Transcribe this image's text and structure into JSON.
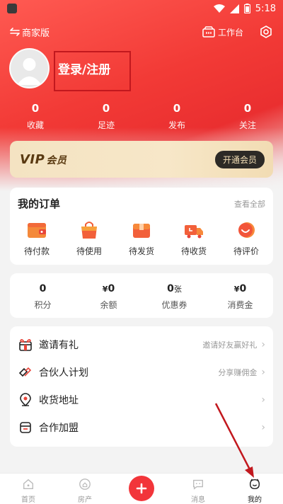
{
  "status_bar": {
    "time": "5:18"
  },
  "header": {
    "merchant_label": "商家版",
    "workbench_label": "工作台"
  },
  "profile": {
    "login_text": "登录/注册"
  },
  "stats": [
    {
      "value": "0",
      "label": "收藏"
    },
    {
      "value": "0",
      "label": "足迹"
    },
    {
      "value": "0",
      "label": "发布"
    },
    {
      "value": "0",
      "label": "关注"
    }
  ],
  "vip": {
    "logo": "VIP",
    "logo_suffix": "会员",
    "button": "开通会员"
  },
  "orders": {
    "title": "我的订单",
    "view_all": "查看全部",
    "items": [
      {
        "label": "待付款",
        "icon": "wallet-icon"
      },
      {
        "label": "待使用",
        "icon": "shopping-bag-icon"
      },
      {
        "label": "待发货",
        "icon": "package-icon"
      },
      {
        "label": "待收货",
        "icon": "delivery-truck-icon"
      },
      {
        "label": "待评价",
        "icon": "review-smile-icon"
      }
    ]
  },
  "wallet": [
    {
      "prefix": "",
      "value": "0",
      "suffix": "",
      "label": "积分"
    },
    {
      "prefix": "¥",
      "value": "0",
      "suffix": "",
      "label": "余额"
    },
    {
      "prefix": "",
      "value": "0",
      "suffix": "张",
      "label": "优惠券"
    },
    {
      "prefix": "¥",
      "value": "0",
      "suffix": "",
      "label": "消费金"
    }
  ],
  "menu": [
    {
      "label": "邀请有礼",
      "hint": "邀请好友赢好礼",
      "icon": "gift-icon"
    },
    {
      "label": "合伙人计划",
      "hint": "分享赚佣金",
      "icon": "handshake-icon"
    },
    {
      "label": "收货地址",
      "hint": "",
      "icon": "location-pin-icon"
    },
    {
      "label": "合作加盟",
      "hint": "",
      "icon": "storefront-icon"
    }
  ],
  "tabbar": [
    {
      "label": "首页",
      "icon": "home-icon"
    },
    {
      "label": "房产",
      "icon": "property-icon"
    },
    {
      "label": "",
      "icon": "plus-icon"
    },
    {
      "label": "消息",
      "icon": "chat-icon"
    },
    {
      "label": "我的",
      "icon": "profile-face-icon"
    }
  ],
  "colors": {
    "brand_red": "#f23a36",
    "annotation": "#c2181e",
    "vip_gold": "#f4e3c2"
  }
}
